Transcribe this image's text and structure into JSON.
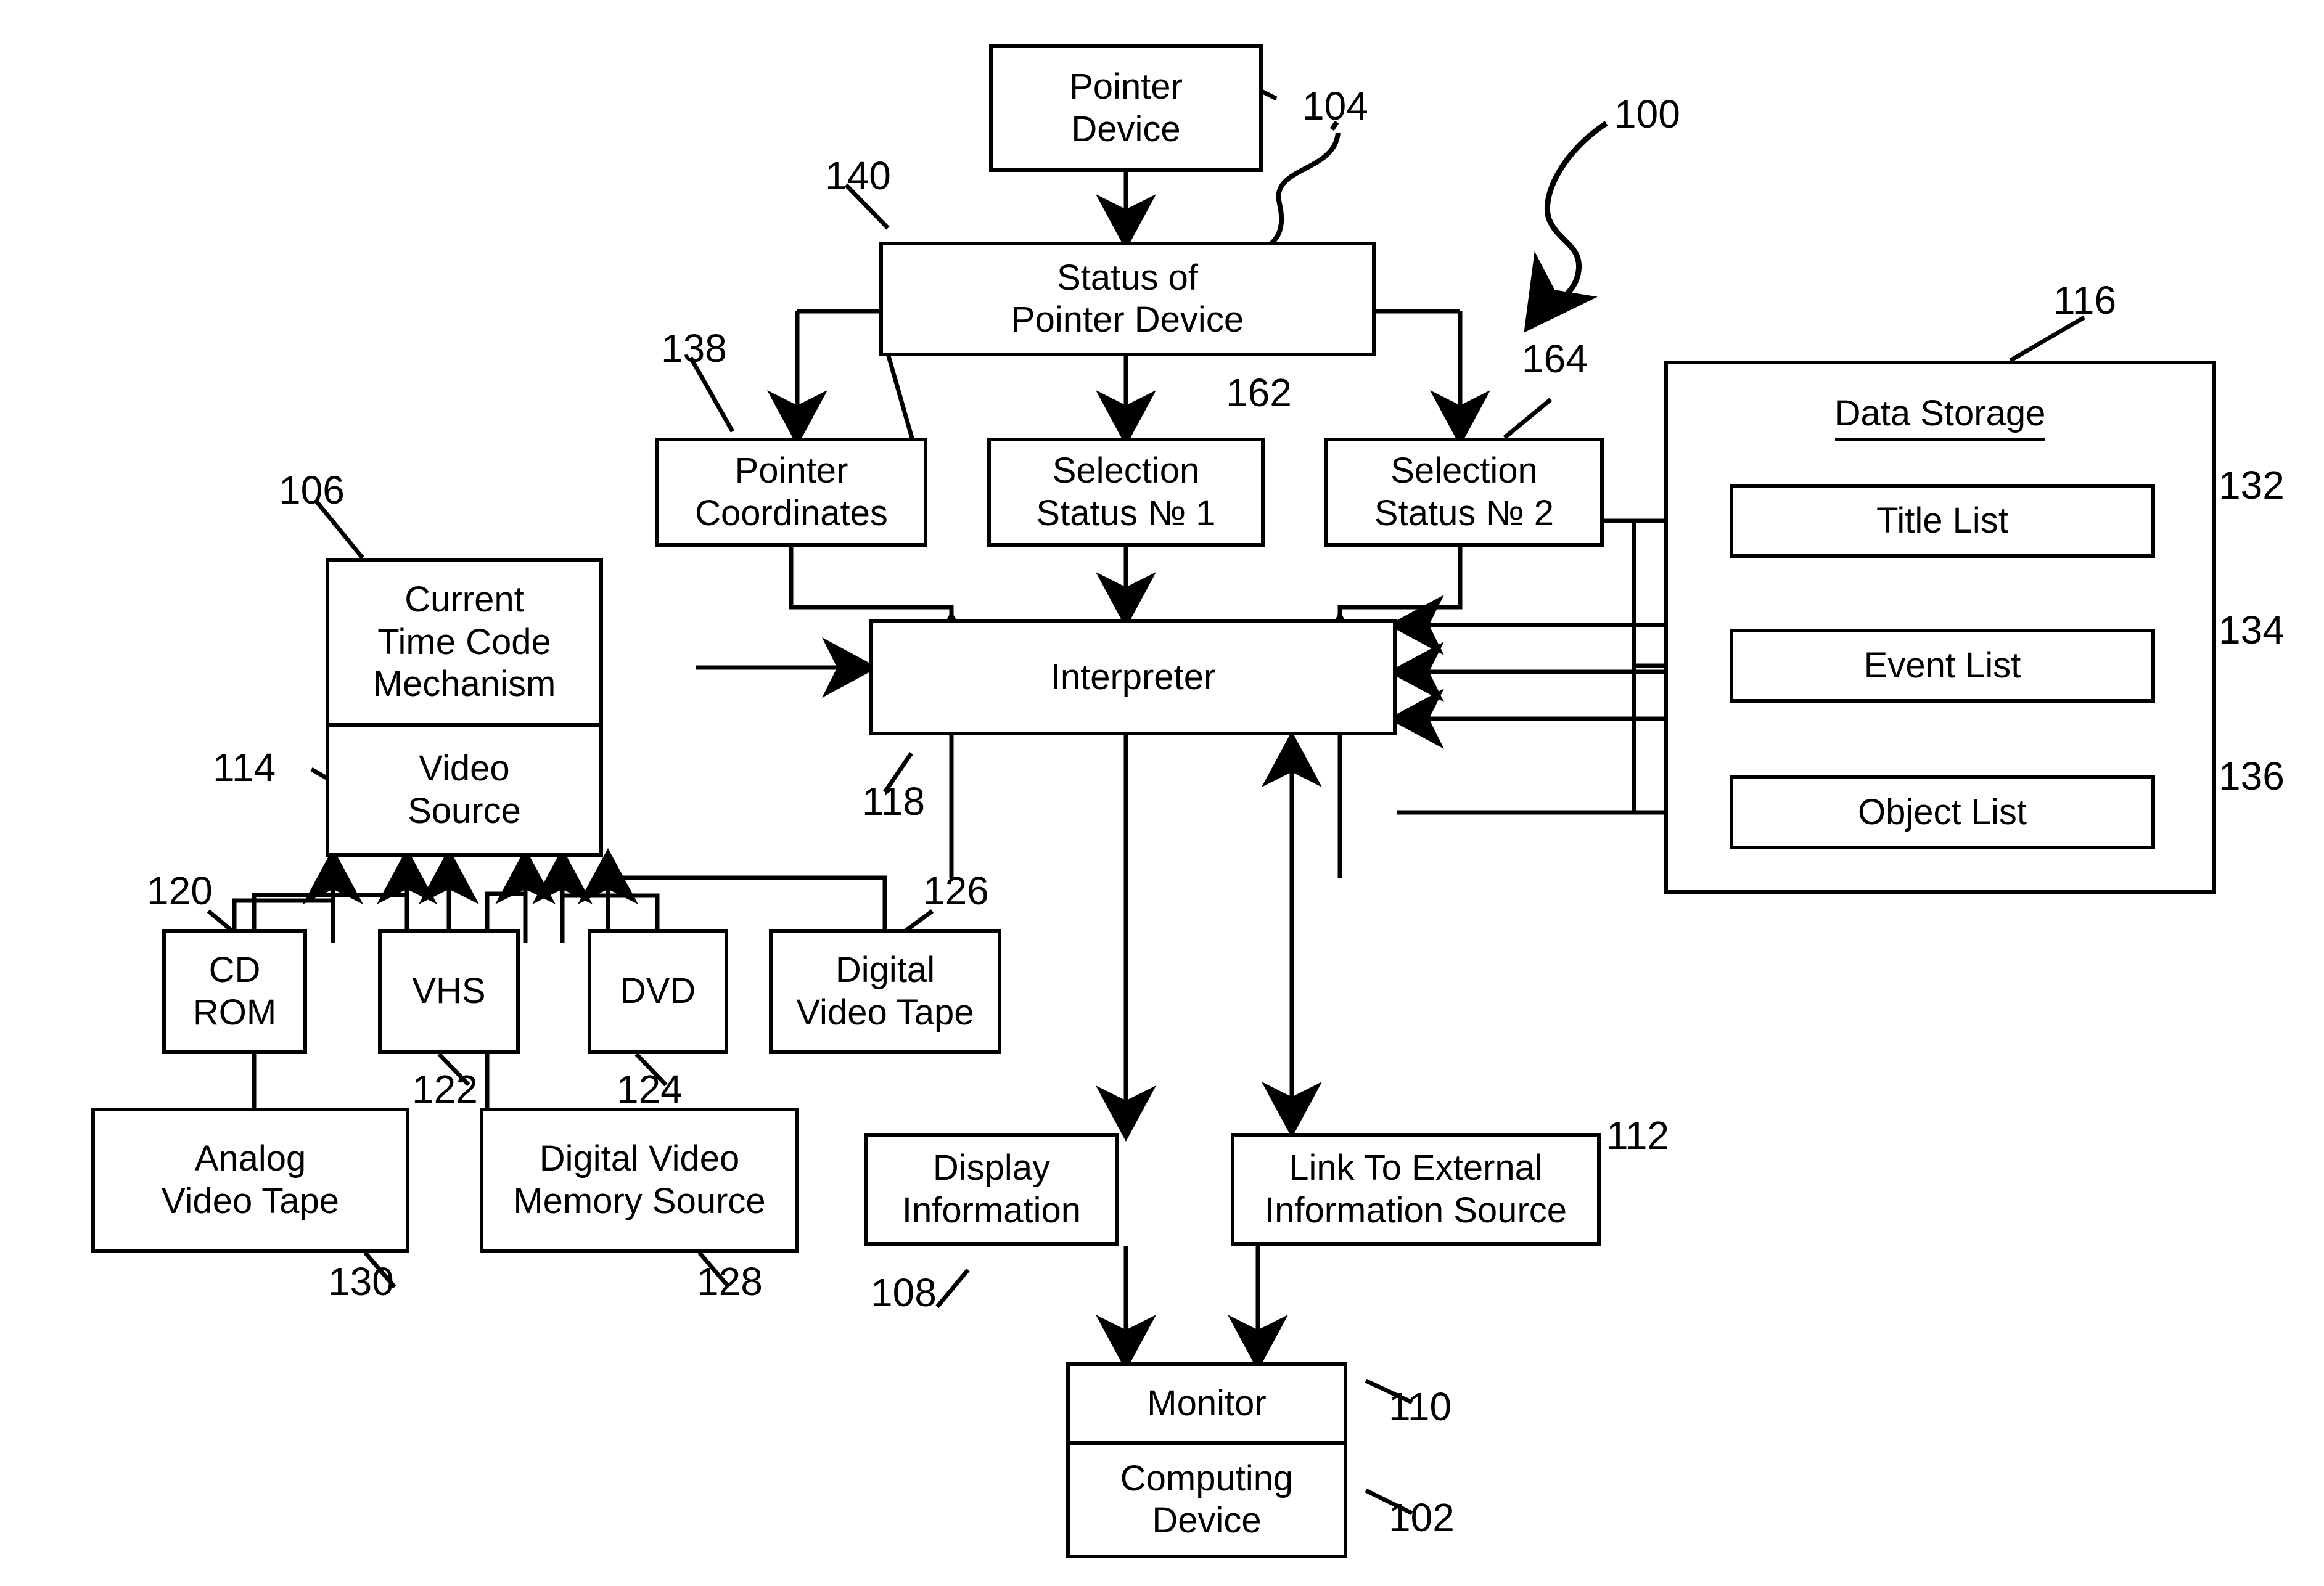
{
  "figure": {
    "type": "patent-block-diagram",
    "system_ref": "100"
  },
  "blocks": {
    "pointer_device": {
      "label_lines": [
        "Pointer",
        "Device"
      ],
      "ref": "104"
    },
    "status_of_pointer_device": {
      "label_lines": [
        "Status of",
        "Pointer Device"
      ],
      "ref": "140"
    },
    "pointer_coordinates": {
      "label_lines": [
        "Pointer",
        "Coordinates"
      ],
      "ref": "138"
    },
    "selection_status_1": {
      "label_lines": [
        "Selection",
        "Status № 1"
      ],
      "ref": "162"
    },
    "selection_status_2": {
      "label_lines": [
        "Selection",
        "Status № 2"
      ],
      "ref": "164"
    },
    "interpreter": {
      "label_lines": [
        "Interpreter"
      ],
      "ref": "118"
    },
    "current_time_code_mechanism": {
      "label_lines": [
        "Current",
        "Time Code",
        "Mechanism"
      ],
      "ref": "106"
    },
    "video_source": {
      "label_lines": [
        "Video",
        "Source"
      ],
      "ref": "114"
    },
    "cd_rom": {
      "label_lines": [
        "CD",
        "ROM"
      ],
      "ref": "120"
    },
    "vhs": {
      "label_lines": [
        "VHS"
      ],
      "ref": "122"
    },
    "dvd": {
      "label_lines": [
        "DVD"
      ],
      "ref": "124"
    },
    "digital_video_tape": {
      "label_lines": [
        "Digital",
        "Video Tape"
      ],
      "ref": "126"
    },
    "analog_video_tape": {
      "label_lines": [
        "Analog",
        "Video Tape"
      ],
      "ref": "130"
    },
    "digital_video_memory_source": {
      "label_lines": [
        "Digital Video",
        "Memory Source"
      ],
      "ref": "128"
    },
    "display_information": {
      "label_lines": [
        "Display",
        "Information"
      ],
      "ref": "108"
    },
    "link_to_external_information_source": {
      "label_lines": [
        "Link To External",
        "Information Source"
      ],
      "ref": "112"
    },
    "monitor": {
      "label_lines": [
        "Monitor"
      ],
      "ref": "110"
    },
    "computing_device": {
      "label_lines": [
        "Computing",
        "Device"
      ],
      "ref": "102"
    },
    "data_storage": {
      "title": "Data Storage",
      "ref": "116"
    },
    "title_list": {
      "label_lines": [
        "Title List"
      ],
      "ref": "132"
    },
    "event_list": {
      "label_lines": [
        "Event List"
      ],
      "ref": "134"
    },
    "object_list": {
      "label_lines": [
        "Object List"
      ],
      "ref": "136"
    }
  },
  "refs": {
    "system": "100",
    "computing_device": "102",
    "pointer_device": "104",
    "current_time_code_mechanism": "106",
    "display_information": "108",
    "monitor": "110",
    "link_external": "112",
    "video_source": "114",
    "data_storage": "116",
    "interpreter": "118",
    "cd_rom": "120",
    "vhs": "122",
    "dvd": "124",
    "digital_video_tape": "126",
    "digital_video_memory_source": "128",
    "analog_video_tape": "130",
    "title_list": "132",
    "event_list": "134",
    "object_list": "136",
    "pointer_coordinates": "138",
    "status_of_pointer_device": "140",
    "selection_status_1": "162",
    "selection_status_2": "164"
  }
}
